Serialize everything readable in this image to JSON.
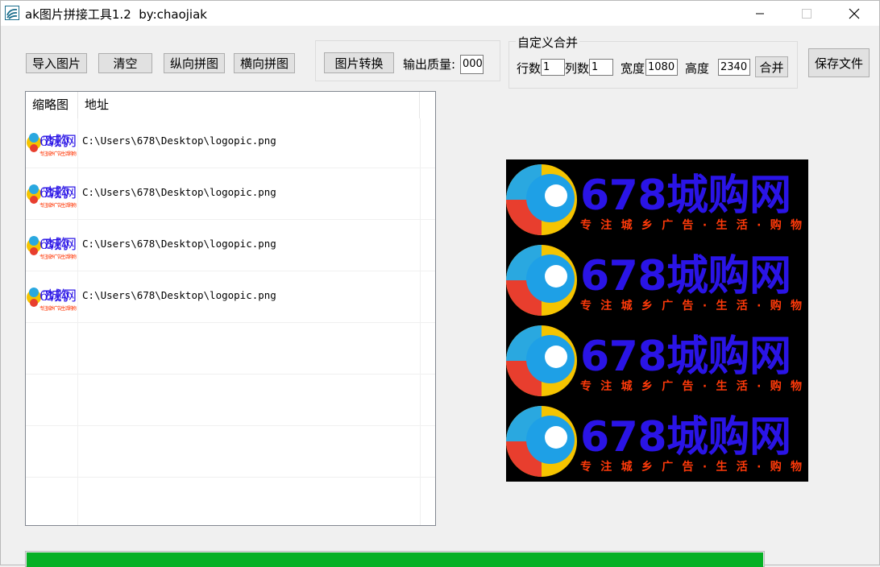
{
  "window": {
    "title": "ak图片拼接工具1.2  by:chaojiak",
    "minimize_icon": "minimize-icon",
    "maximize_icon": "maximize-icon",
    "close_icon": "close-icon"
  },
  "toolbar": {
    "import_label": "导入图片",
    "clear_label": "清空",
    "vertical_label": "纵向拼图",
    "horizontal_label": "横向拼图"
  },
  "convert": {
    "button_label": "图片转换",
    "quality_label": "输出质量:",
    "quality_value": "000"
  },
  "custom_merge": {
    "group_title": "自定义合并",
    "rows_label": "行数",
    "rows_value": "1",
    "cols_label": "列数",
    "cols_value": "1",
    "width_label": "宽度",
    "width_value": "1080",
    "height_label": "高度",
    "height_value": "2340",
    "merge_label": "合并"
  },
  "save_label": "保存文件",
  "file_list": {
    "columns": [
      "缩略图",
      "地址"
    ],
    "rows": [
      {
        "path": "C:\\Users\\678\\Desktop\\logopic.png"
      },
      {
        "path": "C:\\Users\\678\\Desktop\\logopic.png"
      },
      {
        "path": "C:\\Users\\678\\Desktop\\logopic.png"
      },
      {
        "path": "C:\\Users\\678\\Desktop\\logopic.png"
      }
    ]
  },
  "logo": {
    "text": "678城购网",
    "slogan": "专注城乡广告·生活·购物"
  },
  "preview": {
    "tile_count": 4
  },
  "progress": {
    "percent": 100
  },
  "colors": {
    "progress_fill": "#06b025",
    "logo_text": "#2a14e6",
    "logo_slogan": "#ff3a0a"
  }
}
